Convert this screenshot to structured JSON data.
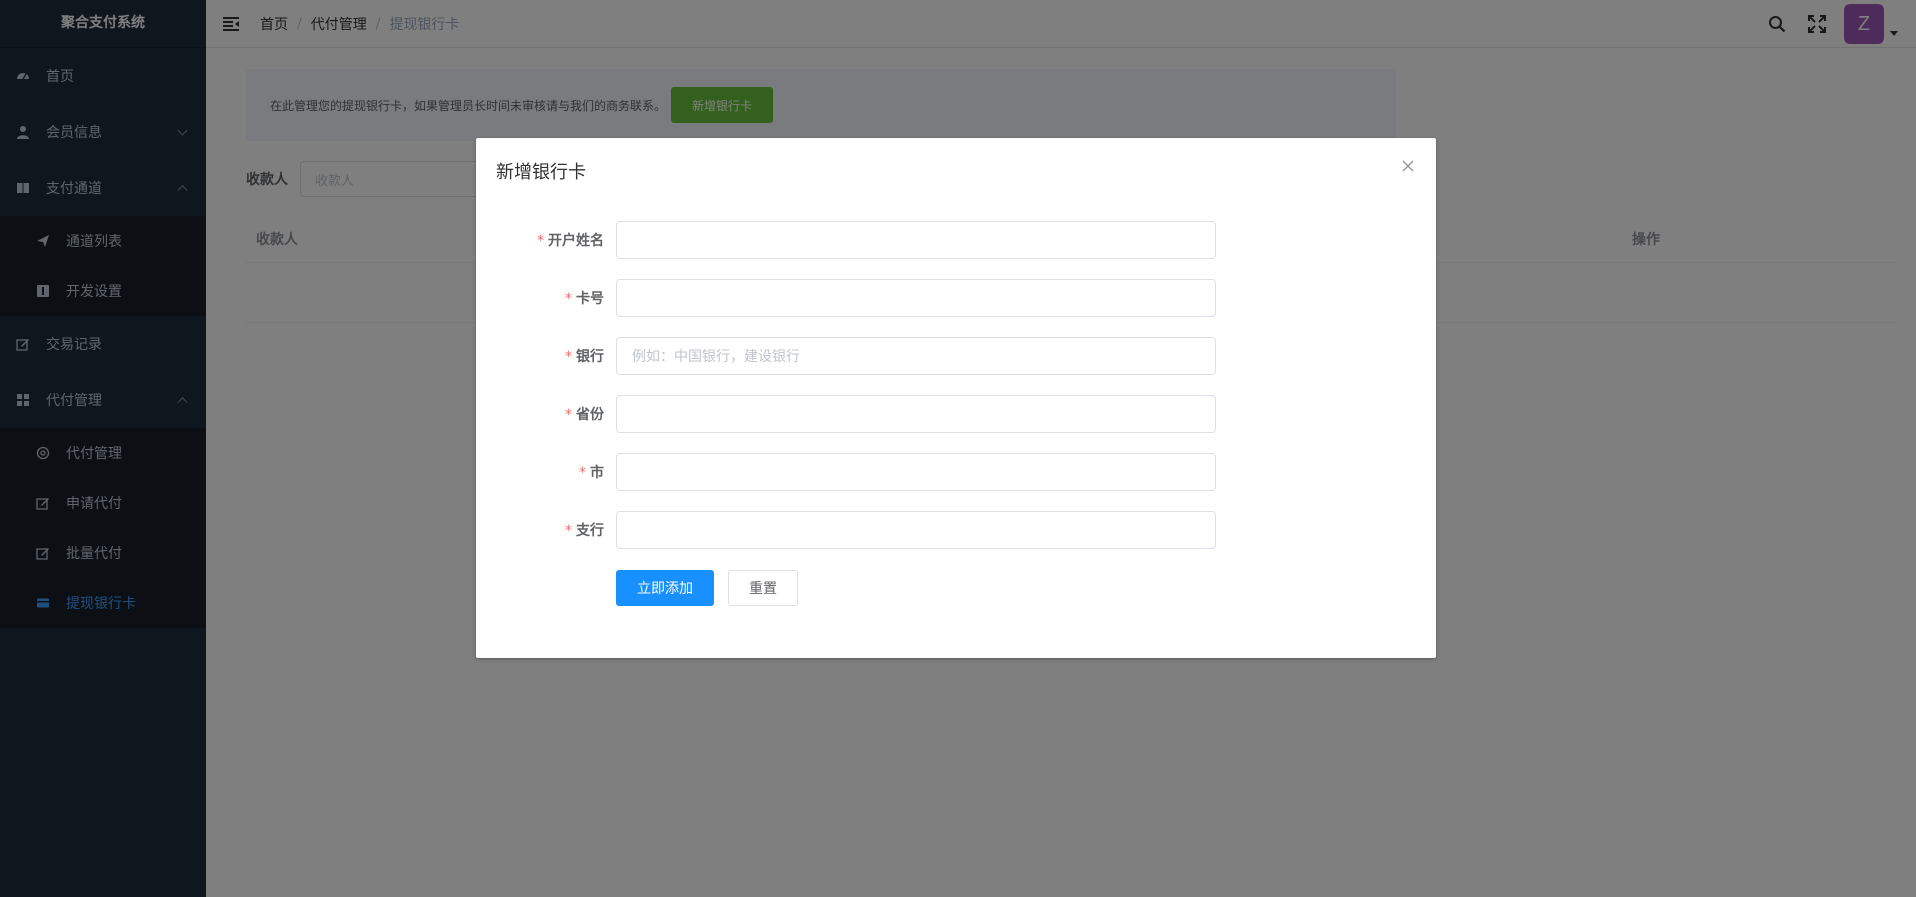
{
  "app": {
    "title": "聚合支付系统"
  },
  "sidebar": {
    "items": [
      {
        "label": "首页",
        "icon": "dashboard-icon"
      },
      {
        "label": "会员信息",
        "icon": "user-icon",
        "expanded": false
      },
      {
        "label": "支付通道",
        "icon": "book-icon",
        "expanded": true,
        "children": [
          {
            "label": "通道列表",
            "icon": "send-icon"
          },
          {
            "label": "开发设置",
            "icon": "code-icon"
          }
        ]
      },
      {
        "label": "交易记录",
        "icon": "edit-icon"
      },
      {
        "label": "代付管理",
        "icon": "grid-icon",
        "expanded": true,
        "children": [
          {
            "label": "代付管理",
            "icon": "at-icon"
          },
          {
            "label": "申请代付",
            "icon": "edit-icon"
          },
          {
            "label": "批量代付",
            "icon": "edit-icon"
          },
          {
            "label": "提现银行卡",
            "icon": "card-icon",
            "active": true
          }
        ]
      }
    ]
  },
  "header": {
    "breadcrumb": [
      "首页",
      "代付管理",
      "提现银行卡"
    ],
    "avatar_letter": "Z"
  },
  "main": {
    "notice_text": "在此管理您的提现银行卡，如果管理员长时间未审核请与我们的商务联系。",
    "notice_button": "新增银行卡",
    "search_label": "收款人",
    "search_placeholder": "收款人",
    "table_columns": [
      "收款人",
      "操作"
    ]
  },
  "dialog": {
    "title": "新增银行卡",
    "fields": [
      {
        "label": "开户姓名",
        "required": true,
        "value": "",
        "placeholder": ""
      },
      {
        "label": "卡号",
        "required": true,
        "value": "",
        "placeholder": ""
      },
      {
        "label": "银行",
        "required": true,
        "value": "",
        "placeholder": "例如：中国银行，建设银行"
      },
      {
        "label": "省份",
        "required": true,
        "value": "",
        "placeholder": ""
      },
      {
        "label": "市",
        "required": true,
        "value": "",
        "placeholder": ""
      },
      {
        "label": "支行",
        "required": true,
        "value": "",
        "placeholder": ""
      }
    ],
    "submit_label": "立即添加",
    "reset_label": "重置"
  },
  "colors": {
    "sidebar_bg": "#1f2d3d",
    "submenu_bg": "#18202b",
    "active": "#409eff",
    "primary": "#1890ff",
    "success": "#67c23a",
    "required": "#f56c6c",
    "avatar": "#9b59b6"
  }
}
